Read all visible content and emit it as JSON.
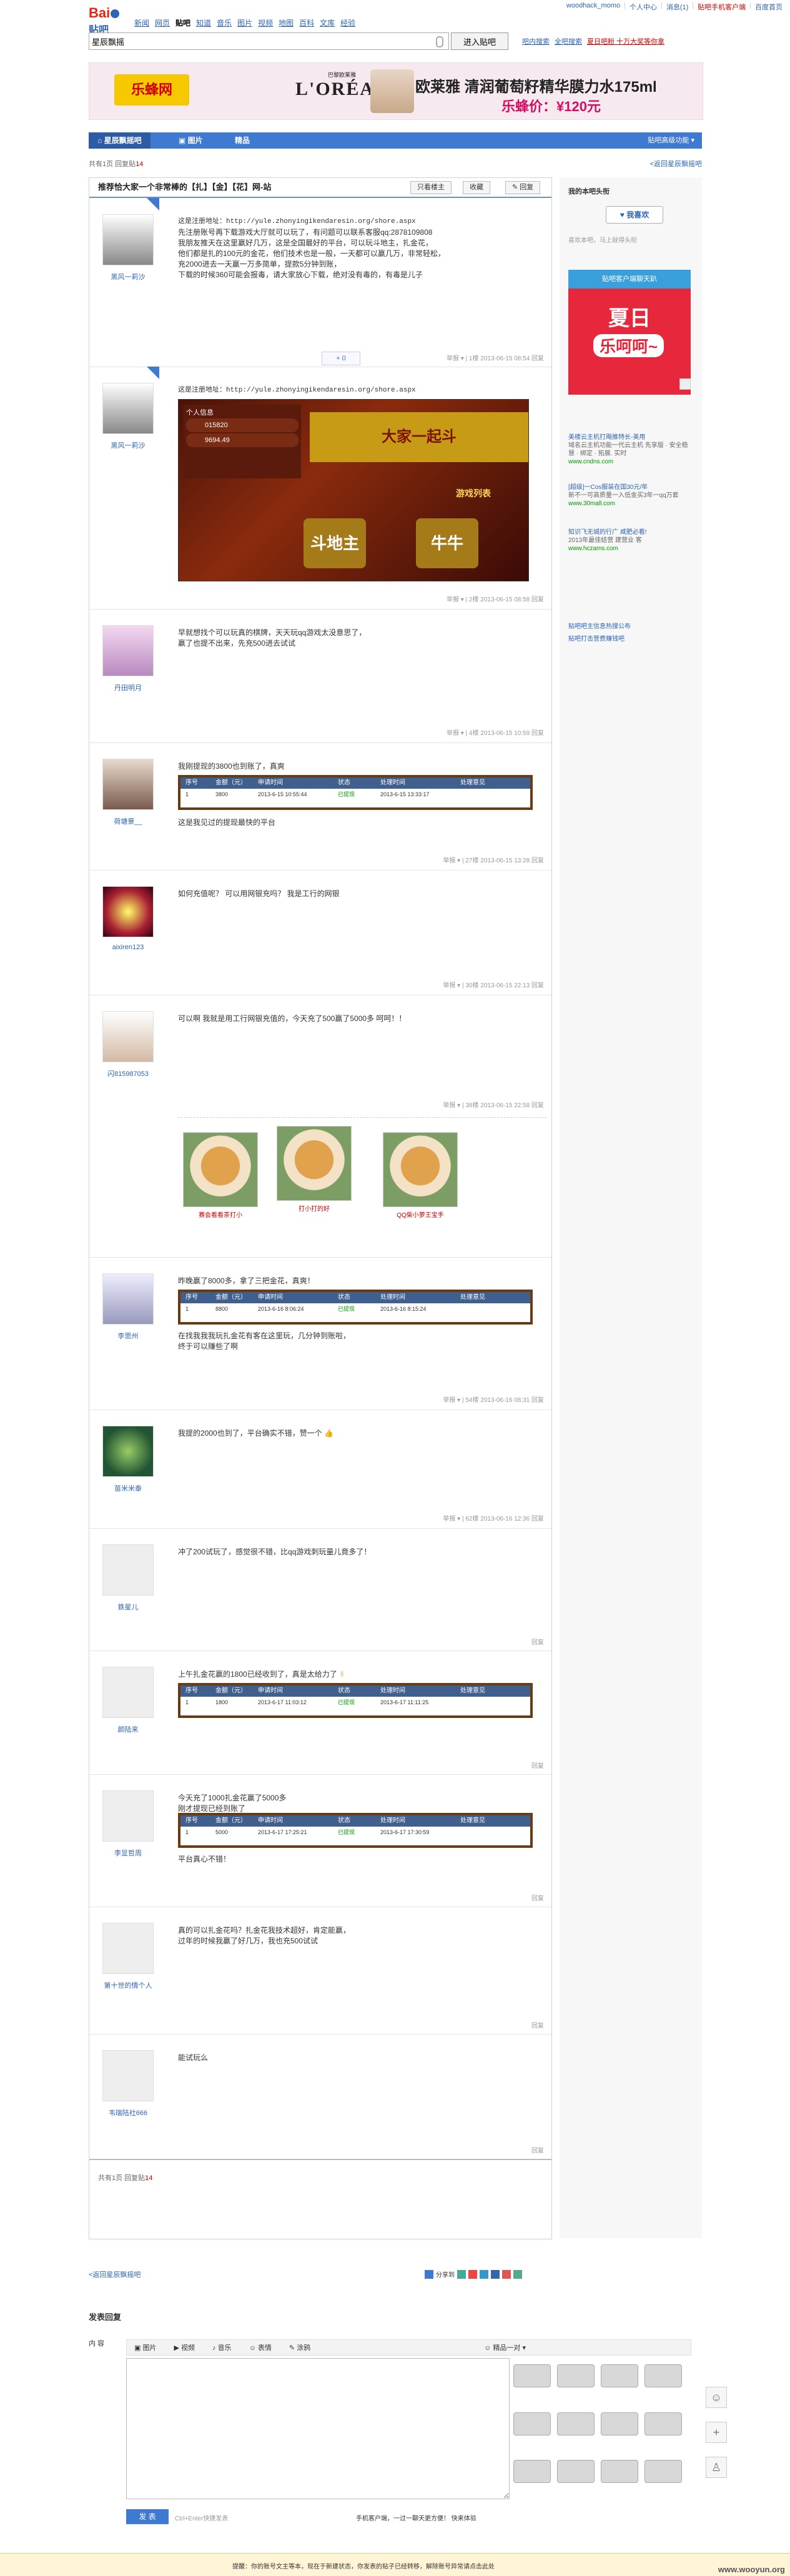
{
  "userbar": {
    "username": "woodhack_momo",
    "center": "个人中心",
    "messages": "消息(1)",
    "mobile": "贴吧手机客户端",
    "home": "百度首页"
  },
  "logo": {
    "bai": "Bai",
    "tieba": "贴吧"
  },
  "nav": [
    "新闻",
    "网页",
    "贴吧",
    "知道",
    "音乐",
    "图片",
    "视频",
    "地图",
    "百科",
    "文库",
    "经验"
  ],
  "search": {
    "value": "星辰飘摇",
    "button": "进入贴吧"
  },
  "quicklinks": [
    "吧内搜索",
    "全吧搜索",
    "夏日吧粉 十万大奖等你拿"
  ],
  "banner": {
    "brand1": "乐蜂网",
    "brand2": "L'ORÉAL",
    "brand2_sub": "巴黎欧莱雅",
    "title": "欧莱雅 清润葡萄籽精华膜力水175ml",
    "price": "乐蜂价：¥120元"
  },
  "tabs": [
    "星辰飘摇吧",
    "图片",
    "精品"
  ],
  "tab_right": "贴吧高级功能",
  "stats": {
    "replies_label": "共有1页 回复贴",
    "replies": "14"
  },
  "backlink": "<返回星辰飘摇吧",
  "thread": {
    "title": "推荐恰大家一个非常棒的【扎】【金】【花】网-站",
    "btn_author": "只看楼主",
    "btn_fav": "收藏",
    "btn_reply": "回复"
  },
  "posts": [
    {
      "user": "黑风一莉沙",
      "lines": [
        "这是注册地址：http://yule.zhonyingikendaresin.org/shore.aspx",
        "先注册账号再下载游戏大厅就可以玩了，有问题可以联系客服qq:2878109808",
        "我朋友推天在这里赢好几万，这是全国最好的平台，可以玩斗地主，扎金花，",
        "他们都是扎的100元的金花，他们技术也是一般，一天都可以赢几万，非常轻松，",
        "充2000进去一天赢一万多简单，提款5分钟到账，",
        "下载的时候360可能会报毒，请大家放心下载，绝对没有毒的，有毒是儿子"
      ],
      "share": "+ 0",
      "meta": "举报 ▾ | 1楼 2013-06-15 08:54 回复"
    },
    {
      "user": "黑风一莉沙",
      "lines": [
        "这是注册地址：http://yule.zhonyingikendaresin.org/shore.aspx"
      ],
      "game": {
        "panel_title": "个人信息",
        "v1": "015820",
        "v2": "9694.49",
        "top": "大家一起斗",
        "list": "游戏列表",
        "b1": "斗地主",
        "b2": "牛牛"
      },
      "meta": "举报 ▾ | 2楼 2013-06-15 08:58 回复"
    },
    {
      "user": "丹田明月",
      "lines": [
        "早就想找个可以玩真的棋牌，天天玩qq游戏太没意思了，",
        "赢了也提不出来，先充500进去试试"
      ],
      "meta": "举报 ▾ | 4楼 2013-06-15 10:59 回复"
    },
    {
      "user": "荷塘景__",
      "lines": [
        "我刚提现的3800也到账了，真爽"
      ],
      "table": {
        "head": [
          "序号",
          "金额（元）",
          "申请时间",
          "状态",
          "处理时间",
          "处理意见"
        ],
        "row": [
          "1",
          "3800",
          "2013-6-15 10:55:44",
          "已提现",
          "2013-6-15 13:33:17",
          ""
        ]
      },
      "after": "这是我见过的提现最快的平台",
      "meta": "举报 ▾ | 27楼 2013-06-15 13:28 回复"
    },
    {
      "user": "aixiren123",
      "lines": [
        "如何充值呢？ 可以用网银充吗？ 我是工行的网银"
      ],
      "meta": "举报 ▾ | 30楼 2013-06-15 22:13 回复"
    },
    {
      "user": "闪815987053",
      "lines": [
        "可以啊 我就是用工行网银充值的，今天充了500赢了5000多 呵呵！！"
      ],
      "meta": "举报 ▾ | 38楼 2013-06-15 22:58 回复",
      "dogs": [
        "赛会看看茶打小",
        "打小打的好",
        "QQ柴小萝王宝手"
      ]
    },
    {
      "user": "李思州",
      "lines": [
        "昨晚赢了8000多，拿了三把金花，真爽！"
      ],
      "table": {
        "head": [
          "序号",
          "金额（元）",
          "申请时间",
          "状态",
          "处理时间",
          "处理意见"
        ],
        "row": [
          "1",
          "8800",
          "2013-6-16 8:06:24",
          "已提现",
          "2013-6-16 8:15:24",
          ""
        ]
      },
      "after": "在找我我我玩扎金花有客在这里玩，几分钟到账啦，\n终于可以赚些了啊",
      "meta": "举报 ▾ | 54楼 2013-06-16 08:31 回复"
    },
    {
      "user": "苗米米泰",
      "lines": [
        "我提的2000也到了，平台确实不错，赞一个"
      ],
      "meta": "举报 ▾ | 62楼 2013-06-16 12:36 回复"
    },
    {
      "user": "鉄星儿",
      "lines": [
        "冲了200试玩了，感觉很不错，比qq游戏刺玩量儿竟多了！"
      ],
      "meta": "回复"
    },
    {
      "user": "颜陆来",
      "lines": [
        "上午扎金花赢的1800已经收到了，真是太给力了"
      ],
      "table": {
        "head": [
          "序号",
          "金额（元）",
          "申请时间",
          "状态",
          "处理时间",
          "处理意见"
        ],
        "row": [
          "1",
          "1800",
          "2013-6-17 11:03:12",
          "已提现",
          "2013-6-17 11:11:25",
          ""
        ]
      },
      "meta": "回复"
    },
    {
      "user": "李显哲周",
      "lines": [
        "今天充了1000扎金花赢了5000多",
        "刚才提现已经到账了"
      ],
      "table": {
        "head": [
          "序号",
          "金额（元）",
          "申请时间",
          "状态",
          "处理时间",
          "处理意见"
        ],
        "row": [
          "1",
          "5000",
          "2013-6-17 17:25:21",
          "已提现",
          "2013-6-17 17:30:59",
          ""
        ]
      },
      "after": "平台真心不错！",
      "meta": "回复"
    },
    {
      "user": "第十世的情个人",
      "lines": [
        "真的可以扎金花吗？扎金花我技术超好，肯定能赢，",
        "过年的时候我赢了好几万，我也充500试试"
      ],
      "meta": "回复"
    },
    {
      "user": "韦瑞陆社666",
      "lines": [
        "能试玩么"
      ],
      "meta": "回复"
    }
  ],
  "sidebar": {
    "heading": "我的本吧头衔",
    "like": "我喜欢",
    "small": "喜欢本吧，马上就得头衔",
    "promo_top": "贴吧客户端聊天趴",
    "promo_big": "夏日",
    "promo_big2": "乐呵呵~",
    "ads": [
      {
        "t": "美楼云主机打飚推特长-美用",
        "d": "域名云主机功能一代云主机 先享版 · 安全稳 慧 · 绑定 · 拓展. 实时",
        "u": "www.cndns.com"
      },
      {
        "t": "[超级]一Cos服装在国30元/年",
        "d": "新不一可高质量一入低金买3年一qq万套",
        "u": "www.30mall.com"
      },
      {
        "t": "知识飞无城的行广 咸肥必看!",
        "d": "2013年最佳结营 建营业 客",
        "u": "www.hczams.com"
      }
    ],
    "links": [
      "贴吧吧主信息热搜公布",
      "贴吧打击营费赚钱吧"
    ]
  },
  "thread_foot": {
    "stats": "共有1页 回复贴",
    "replies": "14"
  },
  "below_back": "<返回星辰飘摇吧",
  "sharebar": "分享到",
  "reply": {
    "title": "发表回复",
    "content_label": "内 容",
    "tools": [
      "图片",
      "视频",
      "音乐",
      "表情",
      "涂鸦"
    ],
    "emoji_label": "精品一对",
    "submit": "发 表",
    "ctrl_hint": "Ctrl+Enter快捷发表",
    "mobile_hint": "手机客户端，一过一聊天更方便！ 快来体验"
  },
  "bottom": {
    "message": "提醒：你的账号文主等本，现在于新建状态，你发表的贴子已经转移，解除账号异常请点击此处",
    "watermark": "www.wooyun.org"
  }
}
